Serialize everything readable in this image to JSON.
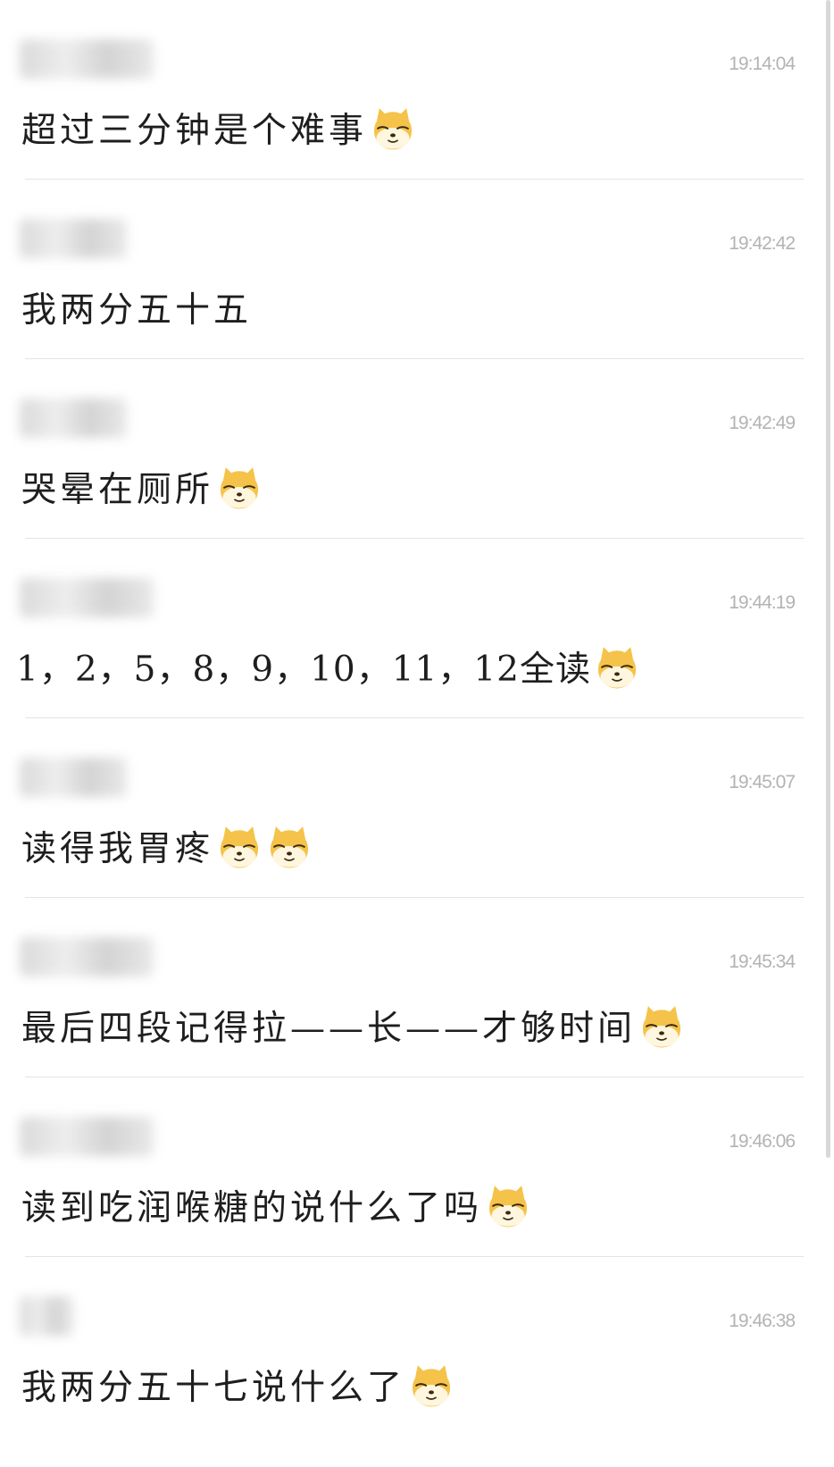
{
  "messages": [
    {
      "time": "19:14:04",
      "text": "超过三分钟是个难事",
      "emoji": [
        "doge-emoji"
      ]
    },
    {
      "time": "19:42:42",
      "text": "我两分五十五",
      "emoji": []
    },
    {
      "time": "19:42:49",
      "text": "哭晕在厕所",
      "emoji": [
        "doge-emoji"
      ]
    },
    {
      "time": "19:44:19",
      "text": "1，2，5，8，9，10，11，12全读",
      "emoji": [
        "doge-emoji"
      ]
    },
    {
      "time": "19:45:07",
      "text": "读得我胃疼",
      "emoji": [
        "doge-emoji",
        "doge-emoji"
      ]
    },
    {
      "time": "19:45:34",
      "text": "最后四段记得拉——长——才够时间",
      "emoji": [
        "doge-emoji"
      ]
    },
    {
      "time": "19:46:06",
      "text": "读到吃润喉糖的说什么了吗",
      "emoji": [
        "doge-emoji"
      ]
    },
    {
      "time": "19:46:38",
      "text": "我两分五十七说什么了",
      "emoji": [
        "doge-emoji"
      ]
    }
  ],
  "colors": {
    "background": "#ffffff",
    "text": "#1e1e1e",
    "timestamp": "#b3b3b3",
    "divider": "#e4e4e4",
    "emoji_fill": "#f5c34a",
    "emoji_face": "#fff6df"
  }
}
